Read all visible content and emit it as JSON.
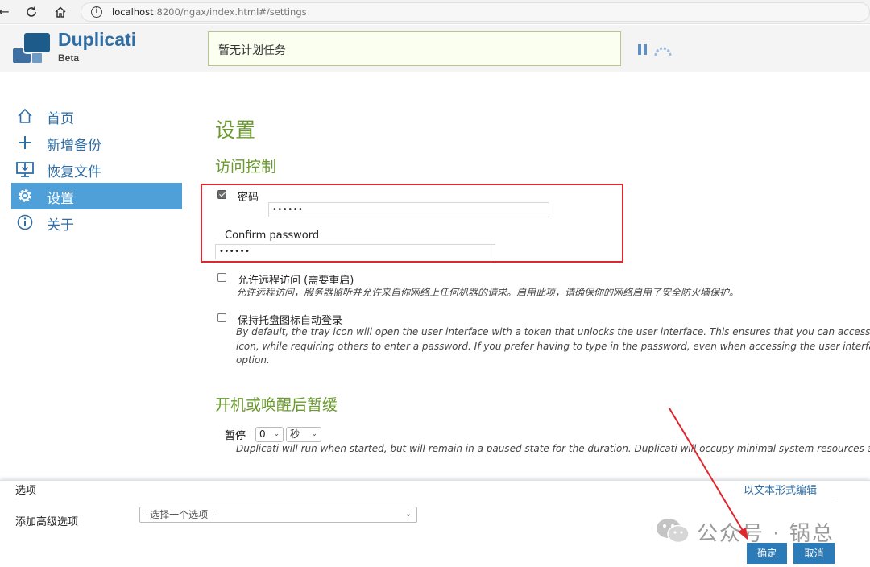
{
  "browser": {
    "url_host": "localhost",
    "url_rest": ":8200/ngax/index.html#/settings"
  },
  "header": {
    "brand": "Duplicati",
    "brand_sub": "Beta",
    "status": "暂无计划任务"
  },
  "sidebar": {
    "items": [
      {
        "label": "首页",
        "icon": "home-icon"
      },
      {
        "label": "新增备份",
        "icon": "plus-icon"
      },
      {
        "label": "恢复文件",
        "icon": "restore-icon"
      },
      {
        "label": "设置",
        "icon": "gear-icon",
        "active": true
      },
      {
        "label": "关于",
        "icon": "info-icon"
      }
    ]
  },
  "main": {
    "title": "设置",
    "access": {
      "title": "访问控制",
      "password_label": "密码",
      "password_value": "••••••",
      "password_checked": true,
      "confirm_label": "Confirm password",
      "confirm_value": "••••••"
    },
    "remote": {
      "label": "允许远程访问 (需要重启)",
      "desc": "允许远程访问，服务器监听并允许来自你网络上任何机器的请求。启用此项，请确保你的网络启用了安全防火墙保护。",
      "checked": false
    },
    "tray": {
      "label": "保持托盘图标自动登录",
      "desc1": "By default, the tray icon will open the user interface with a token that unlocks the user interface. This ensures that you can access the",
      "desc2": "icon, while requiring others to enter a password. If you prefer having to type in the password, even when accessing the user interface t",
      "desc3": "option.",
      "checked": false
    },
    "pause": {
      "title": "开机或唤醒后暂缓",
      "label": "暂停",
      "value": "0",
      "unit": "秒",
      "desc": "Duplicati will run when started, but will remain in a paused state for the duration. Duplicati will occupy minimal system resources and n"
    }
  },
  "footer": {
    "options_title": "选项",
    "text_edit_link": "以文本形式编辑",
    "advanced_label": "添加高级选项",
    "advanced_placeholder": "- 选择一个选项 -",
    "ok_label": "确定",
    "cancel_label": "取消"
  },
  "watermark": {
    "text": "公众号 · 锅总"
  },
  "colors": {
    "accent": "#2f6ea5",
    "heading_green": "#6a9a2e",
    "active_bg": "#4f9fd8",
    "highlight_red": "#e0262e",
    "button_blue": "#2c7bb9"
  }
}
